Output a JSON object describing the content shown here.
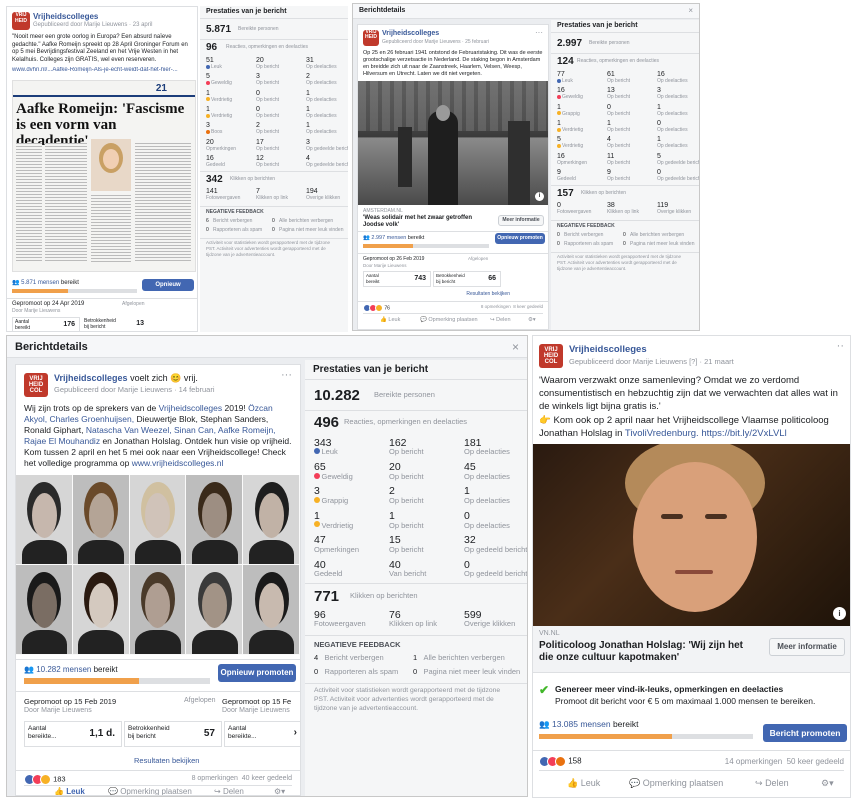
{
  "p1": {
    "page": "Vrijheidscolleges",
    "sponsor": "Gepubliceerd door Marije Lieuwens",
    "date": "23 april",
    "text": "\"Nooit meer een grote oorlog in Europa? Een absurd naïeve gedachte.\" Aafke Romeijn spreekt op 28 April Groninger Forum en op 5 mei Bevrijdingsfestival Zeeland en het Vrije Westen in het Kelalhuis. Colleges zijn GRATIS, wel even reserveren.",
    "link": "www.dvhn.nl/...Aafke-Romeijn-Als-je-echt-weidt-dat-het-hier-...",
    "paper_day": "21",
    "headline": "Aafke Romeijn: 'Fascisme is een vorm van decadentie'",
    "reached_count": "5.871 mensen",
    "reached_suffix": "bereikt",
    "reached_progress": 0.45,
    "promote_btn": "Opnieuw promoten",
    "promoted_label": "Gepromoot op 24 Apr 2019",
    "promoted_by": "Door Marije Lieuwens",
    "promoted_status": "Afgelopen",
    "aantal_label": "Aantal bereikt",
    "aantal_value": "176",
    "betrokken_label": "Betrokkenheid bij bericht",
    "betrokken_value": "13"
  },
  "s1": {
    "title": "Prestaties van je bericht",
    "reach": "5.871",
    "reach_label": "Bereikte personen",
    "eng": "96",
    "eng_label": "Reacties, opmerkingen en deelacties",
    "rows": [
      [
        [
          "51",
          "Leuk"
        ],
        [
          "20",
          "Op bericht"
        ],
        [
          "31",
          "Op deelacties"
        ]
      ],
      [
        [
          "5",
          "Geweldig"
        ],
        [
          "3",
          "Op bericht"
        ],
        [
          "2",
          "Op deelacties"
        ]
      ],
      [
        [
          "1",
          "Verdrietig"
        ],
        [
          "0",
          "Op bericht"
        ],
        [
          "1",
          "Op deelacties"
        ]
      ],
      [
        [
          "1",
          "Verdrietig"
        ],
        [
          "0",
          "Op bericht"
        ],
        [
          "1",
          "Op deelacties"
        ]
      ],
      [
        [
          "3",
          "Boos"
        ],
        [
          "2",
          "Op bericht"
        ],
        [
          "1",
          "Op deelacties"
        ]
      ],
      [
        [
          "20",
          "Opmerkingen"
        ],
        [
          "17",
          "Op bericht"
        ],
        [
          "3",
          "Op gedeelde bericht"
        ]
      ],
      [
        [
          "16",
          "Gedeeld"
        ],
        [
          "12",
          "Op bericht"
        ],
        [
          "4",
          "Op gedeelde bericht"
        ]
      ]
    ],
    "clicks": "342",
    "clicks_label": "Klikken op berichten",
    "click_rows": [
      [
        "141",
        "Fotoweergaven"
      ],
      [
        "7",
        "Klikken op link"
      ],
      [
        "194",
        "Overige klikken"
      ]
    ],
    "neg_title": "NEGATIEVE FEEDBACK",
    "neg": [
      [
        "6",
        "Bericht verbergen"
      ],
      [
        "0",
        "Alle berichten verbergen"
      ],
      [
        "0",
        "Rapporteren als spam"
      ],
      [
        "0",
        "Pagina niet meer leuk vinden"
      ]
    ],
    "footer": "Activiteit voor statistieken wordt gerapporteerd met de tijdzone PST. Activiteit voor advertenties wordt gerapporteerd met de tijdzone van je advertentieaccount."
  },
  "p2": {
    "header": "Berichtdetails",
    "page": "Vrijheidscolleges",
    "sponsor": "Gepubliceerd door Marije Lieuwens",
    "date": "25 februari",
    "text": "Op 25 en 26 februari 1941 ontstond de Februaristaking. Dit was de eerste grootschalige verzetsactie in Nederland. De staking begon in Amsterdam en breidde zich uit naar de Zaanstreek, Haarlem, Velsen, Weesp, Hilversum en Utrecht. Laten we dit niet vergeten.",
    "link_domain": "AMSTERDAM.NL",
    "link_title": "'Weas solidair met het zwaar getroffen Joodse volk'",
    "more_info": "Meer informatie",
    "reached_count": "2.997 mensen",
    "reached_suffix": "bereikt",
    "reached_progress": 0.4,
    "promote_btn": "Opnieuw promoten",
    "promoted_label": "Gepromoot op 26 Feb 2019",
    "promoted_by": "Door Marije Lieuwens",
    "promoted_status": "Afgelopen",
    "aantal_label": "Aantal bereikt",
    "aantal_value": "743",
    "betrokken_label": "Betrokkenheid bij bericht",
    "betrokken_value": "66",
    "results_link": "Resultaten bekijken",
    "react_count": "76",
    "comments": "8 opmerkingen",
    "shares": "8 keer gedeeld",
    "like": "Leuk",
    "comment": "Opmerking plaatsen",
    "share": "Delen"
  },
  "s2": {
    "title": "Prestaties van je bericht",
    "reach": "2.997",
    "reach_label": "Bereikte personen",
    "eng": "124",
    "eng_label": "Reacties, opmerkingen en deelacties",
    "rows": [
      [
        [
          "77",
          "Leuk"
        ],
        [
          "61",
          "Op bericht"
        ],
        [
          "16",
          "Op deelacties"
        ]
      ],
      [
        [
          "16",
          "Geweldig"
        ],
        [
          "13",
          "Op bericht"
        ],
        [
          "3",
          "Op deelacties"
        ]
      ],
      [
        [
          "1",
          "Grappig"
        ],
        [
          "0",
          "Op bericht"
        ],
        [
          "1",
          "Op deelacties"
        ]
      ],
      [
        [
          "1",
          "Verdrietig"
        ],
        [
          "1",
          "Op bericht"
        ],
        [
          "0",
          "Op deelacties"
        ]
      ],
      [
        [
          "5",
          "Verdrietig"
        ],
        [
          "4",
          "Op bericht"
        ],
        [
          "1",
          "Op deelacties"
        ]
      ],
      [
        [
          "16",
          "Opmerkingen"
        ],
        [
          "11",
          "Op bericht"
        ],
        [
          "5",
          "Op gedeelde bericht"
        ]
      ],
      [
        [
          "9",
          "Gedeeld"
        ],
        [
          "9",
          "Op bericht"
        ],
        [
          "0",
          "Op gedeelde bericht"
        ]
      ]
    ],
    "clicks": "157",
    "clicks_label": "Klikken op berichten",
    "click_rows": [
      [
        "0",
        "Fotoweergaven"
      ],
      [
        "38",
        "Klikken op link"
      ],
      [
        "119",
        "Overige klikken"
      ]
    ],
    "neg_title": "NEGATIEVE FEEDBACK",
    "neg": [
      [
        "0",
        "Bericht verbergen"
      ],
      [
        "0",
        "Alle berichten verbergen"
      ],
      [
        "0",
        "Rapporteren als spam"
      ],
      [
        "0",
        "Pagina niet meer leuk vinden"
      ]
    ],
    "footer": "Activiteit voor statistieken wordt gerapporteerd met de tijdzone PST. Activiteit voor advertenties wordt gerapporteerd met de tijdzone van je advertentieaccount."
  },
  "p3": {
    "header": "Berichtdetails",
    "page": "Vrijheidscolleges",
    "feeling": "voelt zich",
    "feeling_word": "vrij.",
    "sponsor": "Gepubliceerd door Marije Lieuwens",
    "date": "14 februari",
    "text_a": "Wij zijn trots op de sprekers van de",
    "text_b": "Vrijheidscolleges",
    "text_c": "2019!",
    "names_blue1": "Özcan Akyol, Charles Groenhuijsen,",
    "names_plain1": "Dieuwertje Blok, Stephan Sanders, Ronald Giphart,",
    "names_blue2": "Natascha Van Weezel, Sinan Can, Aafke Romeijn, Rajae El Mouhandiz",
    "text_d": "en Jonathan Holslag. Ontdek hun visie op vrijheid. Kom tussen 2 april en het 5 mei ook naar een Vrijheidscollege! Check het volledige programma op",
    "text_link": "www.vrijheidscolleges.nl",
    "reached_count": "10.282 mensen",
    "reached_suffix": "bereikt",
    "reached_progress": 0.62,
    "promote_btn": "Opnieuw promoten",
    "promoted_label": "Gepromoot op 15 Feb 2019",
    "promoted_by": "Door Marije Lieuwens",
    "promoted_status": "Afgelopen",
    "aantal_label": "Aantal bereikte...",
    "aantal_value": "1,1 d.",
    "betrokken_label": "Betrokkenheid bij bericht",
    "betrokken_value": "57",
    "promoted_label2": "Gepromoot op 15 Fe",
    "promoted_by2": "Door Marije Lieuwens",
    "aantal_label2": "Aantal bereikte...",
    "results_link": "Resultaten bekijken",
    "react_count": "183",
    "comments": "8 opmerkingen",
    "shares": "40 keer gedeeld",
    "like": "Leuk",
    "comment": "Opmerking plaatsen",
    "share": "Delen"
  },
  "s3": {
    "title": "Prestaties van je bericht",
    "reach": "10.282",
    "reach_label": "Bereikte personen",
    "eng": "496",
    "eng_label": "Reacties, opmerkingen en deelacties",
    "rows": [
      [
        [
          "343",
          "Leuk"
        ],
        [
          "162",
          "Op bericht"
        ],
        [
          "181",
          "Op deelacties"
        ]
      ],
      [
        [
          "65",
          "Geweldig"
        ],
        [
          "20",
          "Op bericht"
        ],
        [
          "45",
          "Op deelacties"
        ]
      ],
      [
        [
          "3",
          "Grappig"
        ],
        [
          "2",
          "Op bericht"
        ],
        [
          "1",
          "Op deelacties"
        ]
      ],
      [
        [
          "1",
          "Verdrietig"
        ],
        [
          "1",
          "Op bericht"
        ],
        [
          "0",
          "Op deelacties"
        ]
      ],
      [
        [
          "47",
          "Opmerkingen"
        ],
        [
          "15",
          "Op bericht"
        ],
        [
          "32",
          "Op gedeeld bericht"
        ]
      ],
      [
        [
          "40",
          "Gedeeld"
        ],
        [
          "40",
          "Van bericht"
        ],
        [
          "0",
          "Op gedeeld bericht"
        ]
      ]
    ],
    "clicks": "771",
    "clicks_label": "Klikken op berichten",
    "click_rows": [
      [
        "96",
        "Fotoweergaven"
      ],
      [
        "76",
        "Klikken op link"
      ],
      [
        "599",
        "Overige klikken"
      ]
    ],
    "neg_title": "NEGATIEVE FEEDBACK",
    "neg": [
      [
        "4",
        "Bericht verbergen"
      ],
      [
        "1",
        "Alle berichten verbergen"
      ],
      [
        "0",
        "Rapporteren als spam"
      ],
      [
        "0",
        "Pagina niet meer leuk vinden"
      ]
    ],
    "footer": "Activiteit voor statistieken wordt gerapporteerd met de tijdzone PST. Activiteit voor advertenties wordt gerapporteerd met de tijdzone van je advertentieaccount."
  },
  "p4": {
    "page": "Vrijheidscolleges",
    "sponsor": "Gepubliceerd door Marije Lieuwens",
    "sponsor_extra": "[?]",
    "date": "21 maart",
    "quote": "'Waarom verzwakt onze samenleving? Omdat we zo verdomd consumentistisch en hebzuchtig zijn dat we verwachten dat alles wat in de winkels ligt bijna gratis is.'",
    "text_a": "Kom ook op 2 april naar het Vrijheidscollege Vlaamse politicoloog Jonathan Holslag in",
    "venue": "TivoliVredenburg.",
    "url": "https://bit.ly/2VxLVLl",
    "link_domain": "VN.NL",
    "link_title": "Politicoloog Jonathan Holslag: 'Wij zijn het die onze cultuur kapotmaken'",
    "more_info": "Meer informatie",
    "boost_title": "Genereer meer vind-ik-leuks, opmerkingen en deelacties",
    "boost_sub": "Promoot dit bericht voor € 5 om maximaal 1.000 mensen te bereiken.",
    "reached_count": "13.085 mensen",
    "reached_suffix": "bereikt",
    "reached_progress": 0.62,
    "promote_btn": "Bericht promoten",
    "react_count": "158",
    "comments": "14 opmerkingen",
    "shares": "50 keer gedeeld",
    "like": "Leuk",
    "comment": "Opmerking plaatsen",
    "share": "Delen"
  },
  "colors": {
    "blue": "#385898",
    "button": "#4267b2",
    "progress": "#f0a04b",
    "green": "#42b72a",
    "logo": "#c0392b"
  }
}
